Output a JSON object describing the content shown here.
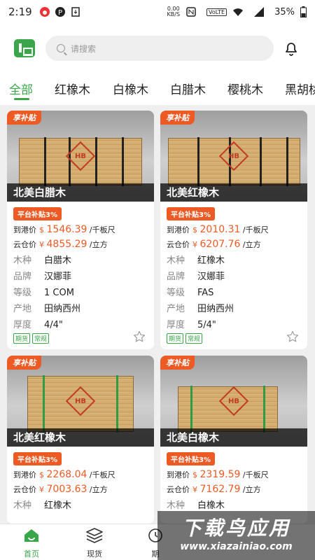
{
  "status": {
    "time": "2:19",
    "speed": "0.00",
    "speed_unit": "KB/S",
    "volte": "VoLTE",
    "battery": "35%"
  },
  "search": {
    "placeholder": "请搜索"
  },
  "tabs": [
    {
      "label": "全部",
      "active": true
    },
    {
      "label": "红橡木"
    },
    {
      "label": "白橡木"
    },
    {
      "label": "白腊木"
    },
    {
      "label": "樱桃木"
    },
    {
      "label": "黑胡桃"
    }
  ],
  "products": [
    {
      "badge": "享补贴",
      "name": "北美白腊木",
      "subsidy": "平台补贴3%",
      "port_label": "到港价",
      "port_currency": "$",
      "port_price": "1546.39",
      "port_unit": "/千板尺",
      "cloud_label": "云仓价",
      "cloud_currency": "¥",
      "cloud_price": "4855.29",
      "cloud_unit": "/立方",
      "specs": [
        {
          "k": "木种",
          "v": "白腊木"
        },
        {
          "k": "品牌",
          "v": "汉娜菲"
        },
        {
          "k": "等级",
          "v": "1 COM"
        },
        {
          "k": "产地",
          "v": "田纳西州"
        },
        {
          "k": "厚度",
          "v": "4/4\""
        }
      ],
      "tags": [
        "期货",
        "常规"
      ]
    },
    {
      "badge": "享补贴",
      "name": "北美红橡木",
      "subsidy": "平台补贴3%",
      "port_label": "到港价",
      "port_currency": "$",
      "port_price": "2010.31",
      "port_unit": "/千板尺",
      "cloud_label": "云仓价",
      "cloud_currency": "¥",
      "cloud_price": "6207.76",
      "cloud_unit": "/立方",
      "specs": [
        {
          "k": "木种",
          "v": "红橡木"
        },
        {
          "k": "品牌",
          "v": "汉娜菲"
        },
        {
          "k": "等级",
          "v": "FAS"
        },
        {
          "k": "产地",
          "v": "田纳西州"
        },
        {
          "k": "厚度",
          "v": "5/4\""
        }
      ],
      "tags": [
        "期货",
        "常规"
      ]
    },
    {
      "badge": "享补贴",
      "name": "北美红橡木",
      "subsidy": "平台补贴3%",
      "port_label": "到港价",
      "port_currency": "$",
      "port_price": "2268.04",
      "port_unit": "/千板尺",
      "cloud_label": "云仓价",
      "cloud_currency": "¥",
      "cloud_price": "7003.63",
      "cloud_unit": "/立方",
      "specs": [
        {
          "k": "木种",
          "v": "红橡木"
        }
      ]
    },
    {
      "badge": "享补贴",
      "name": "北美白橡木",
      "subsidy": "平台补贴3%",
      "port_label": "到港价",
      "port_currency": "$",
      "port_price": "2319.59",
      "port_unit": "/千板尺",
      "cloud_label": "云仓价",
      "cloud_currency": "¥",
      "cloud_price": "7162.79",
      "cloud_unit": "/立方",
      "specs": [
        {
          "k": "木种",
          "v": "白橡木"
        }
      ]
    }
  ],
  "hb_mark": "HB",
  "bottom_nav": [
    {
      "label": "首页",
      "icon": "home-icon",
      "active": true
    },
    {
      "label": "现货",
      "icon": "stack-icon"
    },
    {
      "label": "期",
      "icon": "futures-icon"
    }
  ],
  "watermark": {
    "title": "下载鸟应用",
    "url": "www.xiazainiao.com"
  },
  "colors": {
    "brand_green": "#3aa64a",
    "accent_orange": "#ee5a24"
  }
}
